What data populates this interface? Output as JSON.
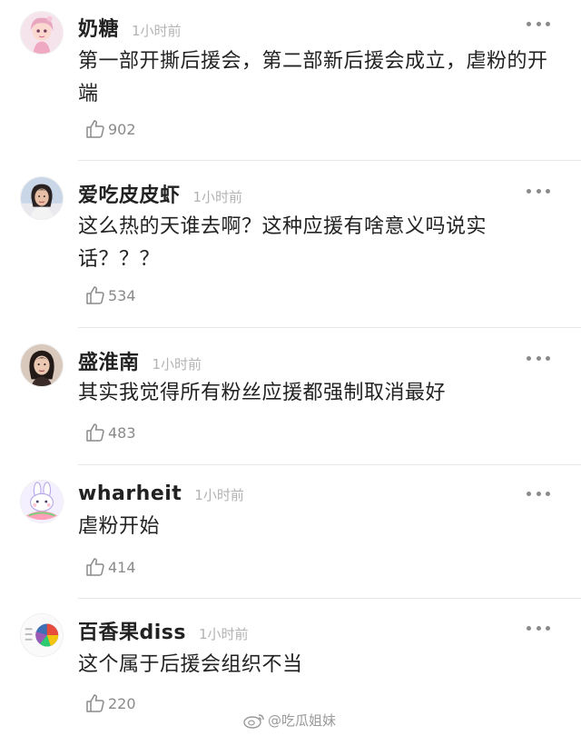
{
  "comments": [
    {
      "username": "奶糖",
      "time": "1小时前",
      "text": "第一部开撕后援会，第二部新后援会成立，虐粉的开端",
      "likes": "902",
      "avatar_icon": "anime-girl-avatar"
    },
    {
      "username": "爱吃皮皮虾",
      "time": "1小时前",
      "text": "这么热的天谁去啊？这种应援有啥意义吗说实话？？？",
      "likes": "534",
      "avatar_icon": "woman-photo-avatar"
    },
    {
      "username": "盛淮南",
      "time": "1小时前",
      "text": "其实我觉得所有粉丝应援都强制取消最好",
      "likes": "483",
      "avatar_icon": "woman-portrait-avatar"
    },
    {
      "username": "wharheit",
      "time": "1小时前",
      "text": "虐粉开始",
      "likes": "414",
      "avatar_icon": "bunny-cartoon-avatar"
    },
    {
      "username": "百香果diss",
      "time": "1小时前",
      "text": "这个属于后援会组织不当",
      "likes": "220",
      "avatar_icon": "pie-chart-avatar"
    }
  ],
  "watermark": {
    "text": "@吃瓜姐妹",
    "icon": "weibo-logo-icon"
  },
  "colors": {
    "username": "#222222",
    "time": "#b3b3b3",
    "like": "#8a8a8a"
  }
}
